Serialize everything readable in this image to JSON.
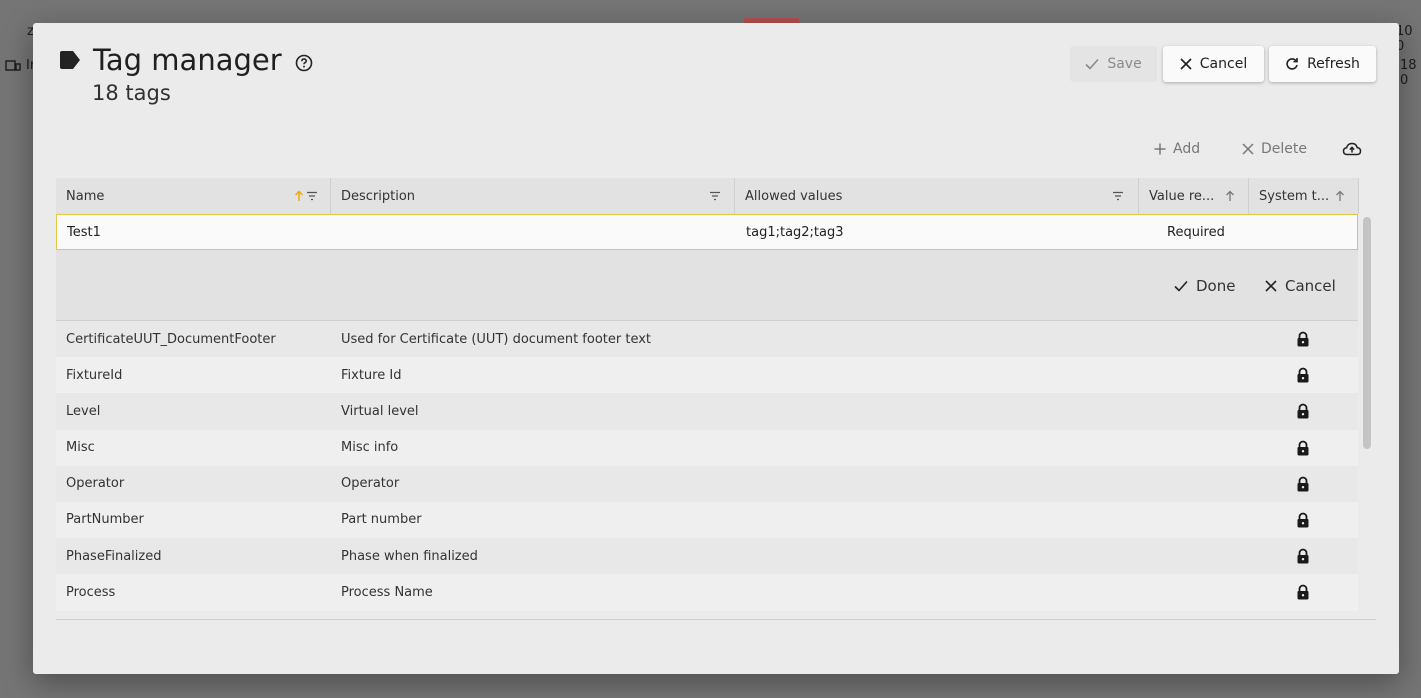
{
  "background": {
    "left_text_1": "z",
    "left_text_2": "In",
    "right_text_1": "10 0",
    "right_text_2": "18 0"
  },
  "dialog": {
    "title": "Tag manager",
    "subtitle": "18 tags",
    "buttons": {
      "save": "Save",
      "cancel": "Cancel",
      "refresh": "Refresh"
    },
    "toolbar": {
      "add": "Add",
      "delete": "Delete"
    }
  },
  "grid": {
    "columns": [
      "Name",
      "Description",
      "Allowed values",
      "Value re...",
      "System t..."
    ],
    "edit_row": {
      "name": "Test1",
      "description": "",
      "allowed_values": "tag1;tag2;tag3",
      "value_required": "Required"
    },
    "edit_actions": {
      "done": "Done",
      "cancel": "Cancel"
    },
    "rows": [
      {
        "name": "CertificateUUT_DocumentFooter",
        "description": "Used for Certificate (UUT) document footer text"
      },
      {
        "name": "FixtureId",
        "description": "Fixture Id"
      },
      {
        "name": "Level",
        "description": "Virtual level"
      },
      {
        "name": "Misc",
        "description": "Misc info"
      },
      {
        "name": "Operator",
        "description": "Operator"
      },
      {
        "name": "PartNumber",
        "description": "Part number"
      },
      {
        "name": "PhaseFinalized",
        "description": "Phase when finalized"
      },
      {
        "name": "Process",
        "description": "Process Name"
      }
    ]
  },
  "colors": {
    "accent": "#e2c744",
    "sort_asc": "#f0a500"
  }
}
